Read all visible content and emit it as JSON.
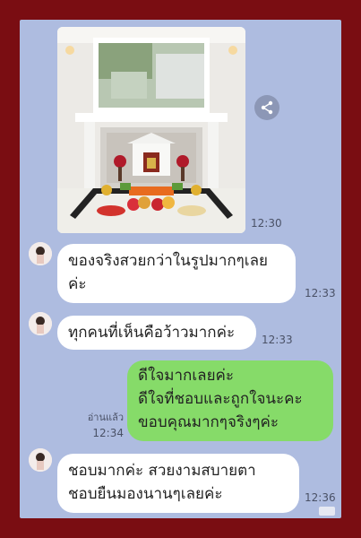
{
  "messages": [
    {
      "kind": "image",
      "time": "12:30"
    },
    {
      "kind": "incoming",
      "text_line1": "ของจริงสวยกว่าในรูปมากๆเลย",
      "text_line2": "ค่ะ",
      "time": "12:33"
    },
    {
      "kind": "incoming",
      "text": "ทุกคนที่เห็นคือว้าวมากค่ะ",
      "time": "12:33"
    },
    {
      "kind": "outgoing",
      "lines": [
        "ดีใจมากเลยค่ะ",
        "ดีใจที่ชอบและถูกใจนะคะ",
        "ขอบคุณมากๆจริงๆค่ะ"
      ],
      "read_label": "อ่านแล้ว",
      "time": "12:34"
    },
    {
      "kind": "incoming",
      "lines": [
        "ชอบมากค่ะ สวยงามสบายตา",
        "ชอบยืนมองนานๆเลยค่ะ"
      ],
      "time": "12:36"
    }
  ],
  "icons": {
    "share": "share-icon",
    "avatar": "avatar-image"
  },
  "colors": {
    "border": "#7a0d12",
    "chat_bg": "#aebce0",
    "outgoing": "#86db69",
    "incoming": "#ffffff"
  }
}
